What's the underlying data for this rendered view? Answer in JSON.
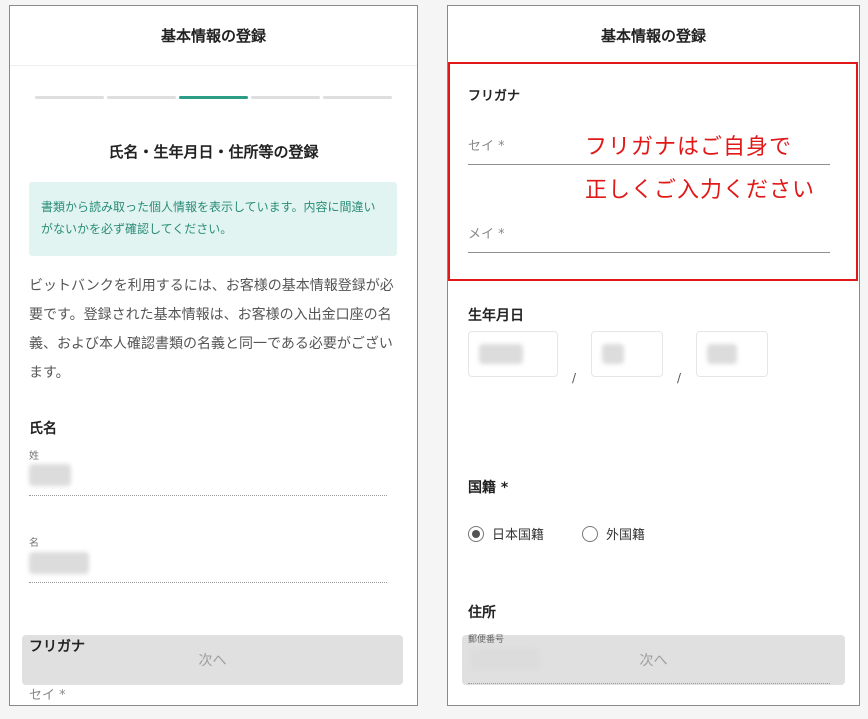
{
  "left": {
    "header_title": "基本情報の登録",
    "section_title": "氏名・生年月日・住所等の登録",
    "notice": "書類から読み取った個人情報を表示しています。内容に間違いがないかを必ず確認してください。",
    "description": "ビットバンクを利用するには、お客様の基本情報登録が必要です。登録された基本情報は、お客様の入出金口座の名義、および本人確認書類の名義と同一である必要がございます。",
    "name_group_title": "氏名",
    "last_name_label": "姓",
    "first_name_label": "名",
    "furigana_title": "フリガナ",
    "sei_label": "セイ *",
    "next_button": "次へ",
    "progress": {
      "total_steps": 5,
      "current_step": 3
    }
  },
  "right": {
    "header_title": "基本情報の登録",
    "furigana_title": "フリガナ",
    "sei_label": "セイ *",
    "mei_label": "メイ *",
    "annotation_line1": "フリガナはご自身で",
    "annotation_line2": "正しくご入力ください",
    "birthdate_title": "生年月日",
    "date_separator": "/",
    "nationality_title": "国籍 *",
    "nationality_options": [
      {
        "label": "日本国籍",
        "selected": true
      },
      {
        "label": "外国籍",
        "selected": false
      }
    ],
    "address_title": "住所",
    "postal_label": "郵便番号",
    "next_button": "次へ"
  },
  "colors": {
    "accent": "#2a9d84",
    "notice_bg": "#e2f4f1",
    "notice_text": "#2a8c78",
    "annotation_red": "#e01818",
    "button_bg": "#e0e0e0"
  }
}
